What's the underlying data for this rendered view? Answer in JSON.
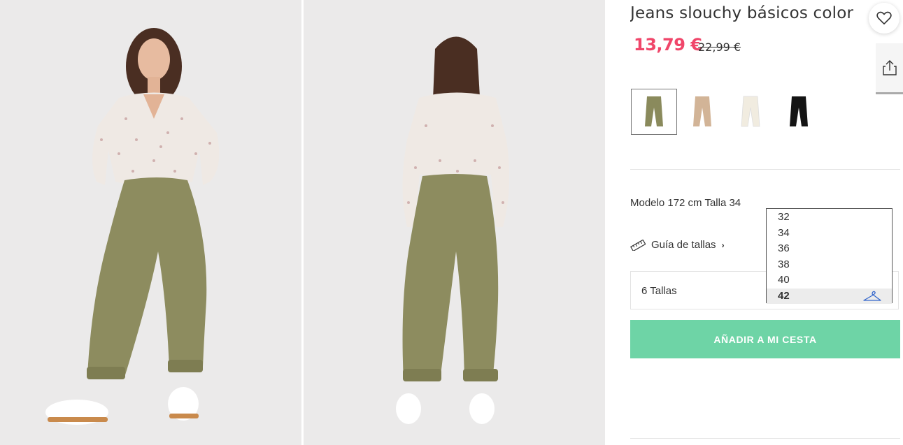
{
  "product": {
    "title": "Jeans slouchy básicos color",
    "price_current": "13,79 €",
    "price_old": "22,99 €",
    "model_info": "Modelo 172 cm Talla 34",
    "size_guide": "Guía de tallas",
    "size_summary": "6 Tallas",
    "add_to_cart": "AÑADIR A MI CESTA"
  },
  "colors": [
    {
      "name": "khaki",
      "hex": "#8a8a5c",
      "selected": true
    },
    {
      "name": "beige",
      "hex": "#d2b497",
      "selected": false
    },
    {
      "name": "ecru",
      "hex": "#f1ece0",
      "selected": false
    },
    {
      "name": "black",
      "hex": "#141414",
      "selected": false
    }
  ],
  "sizes": [
    "32",
    "34",
    "36",
    "38",
    "40",
    "42"
  ],
  "highlighted_size": "42",
  "icons": {
    "favorite": "heart-icon",
    "share": "share-icon",
    "guide": "ruler-icon",
    "hanger": "hanger-icon",
    "chevron": "chevron-right-icon"
  },
  "theme": {
    "sale_color": "#f0466a",
    "cart_color": "#6ed4a6",
    "hanger_color": "#3366cc"
  }
}
